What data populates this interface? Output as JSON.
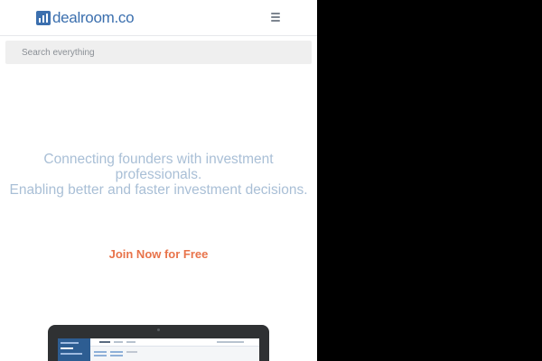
{
  "header": {
    "logo_text": "dealroom.co",
    "logo_icon": "bar-chart-logo-icon",
    "menu_icon": "hamburger-menu-icon"
  },
  "search": {
    "placeholder": "Search everything",
    "value": ""
  },
  "hero": {
    "line1": "Connecting founders with investment",
    "line2": "professionals.",
    "line3": "Enabling better and faster investment decisions."
  },
  "cta": {
    "label": "Join Now for Free"
  },
  "colors": {
    "brand": "#3b6fae",
    "hero_text": "#a9bfd6",
    "cta": "#e8734a",
    "search_bg": "#efefef"
  },
  "preview": {
    "icon": "laptop-device-icon"
  }
}
